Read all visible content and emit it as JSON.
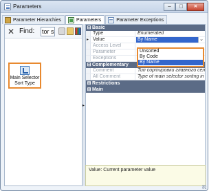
{
  "window": {
    "title": "Parameters"
  },
  "tabs": [
    {
      "label": "Parameter Hierarchies"
    },
    {
      "label": "Parameters"
    },
    {
      "label": "Parameter Exceptions"
    }
  ],
  "toolbar": {
    "close_glyph": "✕",
    "find_label": "Find:",
    "search_value": "tor s"
  },
  "tree": {
    "selected_label": "Main Selector Sort Type"
  },
  "grid": {
    "categories": {
      "basic": "Basic",
      "complementary": "Complementary",
      "restrictions": "Restrictions",
      "main": "Main"
    },
    "rows": {
      "type": {
        "name": "Type",
        "value": "Enumerated"
      },
      "value": {
        "name": "Value",
        "value": "By Name"
      },
      "access_level": {
        "name": "Access Level",
        "value": ""
      },
      "parameter": {
        "name": "Parameter",
        "value": ""
      },
      "exceptions": {
        "name": "Exceptions",
        "checked": true
      },
      "comment": {
        "name": "Comment",
        "value": "Тип сортировки главного селектора"
      },
      "all_comment": {
        "name": "All Comment",
        "value": "Type of main selector sorting in control"
      }
    }
  },
  "dropdown": {
    "options": [
      "Unsorted",
      "By Code",
      "By Name"
    ],
    "selected": "By Name"
  },
  "description": {
    "text": "Value: Current parameter value"
  },
  "icons": [
    "parameters-app-icon",
    "hierarchy-icon",
    "parameters-icon",
    "exceptions-icon",
    "binoculars-icon",
    "folder-icon",
    "palette-icon",
    "parameter-item-icon"
  ],
  "colors": {
    "highlight_border": "#e8892f",
    "selection_blue": "#3366cc",
    "category_header": "#5b6b86"
  }
}
